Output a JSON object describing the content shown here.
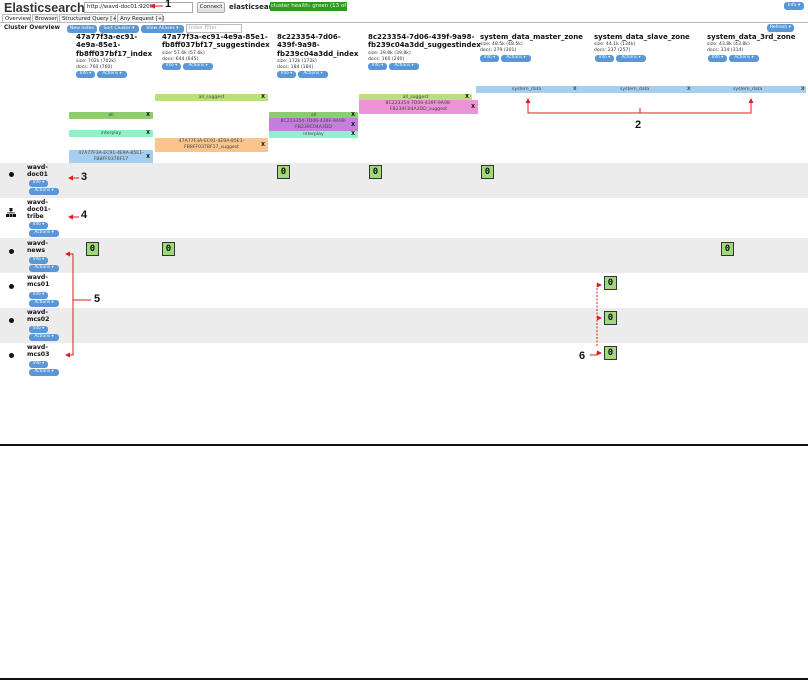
{
  "header": {
    "title": "Elasticsearch",
    "url_value": "http://wavd-doc01:9200/",
    "connect_label": "Connect",
    "cluster_name": "elasticsearch",
    "health": "cluster health: green (13 of 19)",
    "info_label": "Info ▾",
    "health_color": "#2d9c1f"
  },
  "tabs": [
    "Overview",
    "Browser",
    "Structured Query [+]",
    "Any Request [+]"
  ],
  "toolbar": {
    "section_label": "Cluster Overview",
    "new_index": "New Index",
    "sort_cluster": "Sort Cluster ▾",
    "view_aliases": "View Aliases ▾",
    "filter_placeholder": "Index Filter",
    "refresh": "Refresh ▾"
  },
  "indices": [
    {
      "name": [
        "47a77f3a-ec91-",
        "4e9a-85e1-",
        "fb8ff037bf17_index"
      ],
      "size": "size: 702k (702k)",
      "docs": "docs: 760 (760)"
    },
    {
      "name": [
        "47a77f3a-ec91-4e9a-85e1-",
        "fb8ff037bf17_suggestindex"
      ],
      "size": "size: 57.6k (57.6k)",
      "docs": "docs: 644 (645)"
    },
    {
      "name": [
        "8c223354-7d06-",
        "439f-9a98-",
        "fb239c04a3dd_index"
      ],
      "size": "size: 172k (172k)",
      "docs": "docs: 184 (184)"
    },
    {
      "name": [
        "8c223354-7d06-439f-9a98-",
        "fb239c04a3dd_suggestindex"
      ],
      "size": "size: 39.8k (39.8k)",
      "docs": "docs: 160 (240)"
    },
    {
      "name": [
        "system_data_master_zone"
      ],
      "size": "size: 48.5k (48.5k)",
      "docs": "docs: 279 (301)"
    },
    {
      "name": [
        "system_data_slave_zone"
      ],
      "size": "size: 44.1k (134k)",
      "docs": "docs: 237 (257)"
    },
    {
      "name": [
        "system_data_3rd_zone"
      ],
      "size": "size: 43.8k (43.8k)",
      "docs": "docs: 314 (314)"
    }
  ],
  "index_buttons": {
    "info": "Info ▾",
    "actions": "Actions ▾"
  },
  "aliases": {
    "all_suggest": "all_suggest",
    "all": "all",
    "interplay": "interplay",
    "system_data": "system_data",
    "suggest_47a_l1": "47A77F3A-EC91-4E9A-85E1-",
    "suggest_47a_l2": "FB8FF037BF17_suggest",
    "idx_47a_l1": "47A77F3A-EC91-4E9A-85E1-",
    "idx_47a_l2": "FB8FF037BF17",
    "idx_8c2_l1": "8C223354-7D06-439F-9A98-",
    "idx_8c2_l2": "FB239C04A3DD",
    "suggest_8c2_l1": "8C223354-7D06-439F-9A98-",
    "suggest_8c2_l2": "FB239C04A3DD_suggest",
    "close": "X"
  },
  "nodes": [
    {
      "name": [
        "wavd-",
        "doc01"
      ],
      "icon": "node-dot"
    },
    {
      "name": [
        "wavd-",
        "doc01-",
        "tribe"
      ],
      "icon": "tribe-icon"
    },
    {
      "name": [
        "wavd-",
        "news"
      ],
      "icon": "node-dot"
    },
    {
      "name": [
        "wavd-",
        "mcs01"
      ],
      "icon": "node-dot"
    },
    {
      "name": [
        "wavd-",
        "mcs02"
      ],
      "icon": "node-dot"
    },
    {
      "name": [
        "wavd-",
        "mcs03"
      ],
      "icon": "node-dot"
    }
  ],
  "node_buttons": {
    "info": "Info ▾",
    "actions": "Actions ▾"
  },
  "shard_value": "0",
  "callouts": [
    "1",
    "2",
    "3",
    "4",
    "5",
    "6"
  ],
  "colors": {
    "button_blue": "#5b97d6",
    "shard_green": "#9fd97a",
    "arrow_red": "#e01b1b"
  }
}
